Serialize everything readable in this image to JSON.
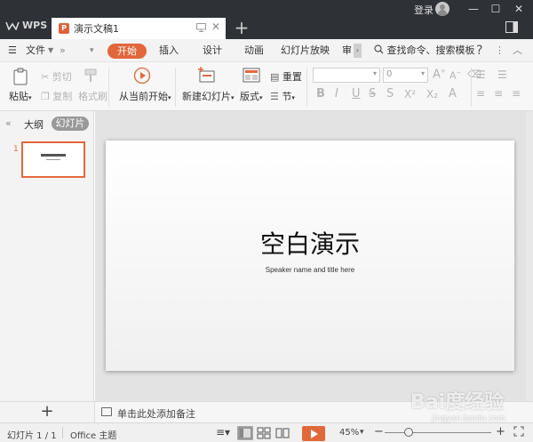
{
  "titlebar": {
    "app_name": "WPS",
    "doc_tab": "演示文稿1",
    "login": "登录",
    "new_tab": "+",
    "close_tab": "✕"
  },
  "menu": {
    "file": "文件",
    "tabs": [
      "开始",
      "插入",
      "设计",
      "动画",
      "幻灯片放映",
      "审"
    ],
    "active_tab": "开始",
    "search": "查找命令、搜索模板",
    "help": "?"
  },
  "ribbon": {
    "paste": "粘贴",
    "cut": "剪切",
    "copy": "复制",
    "format_painter": "格式刷",
    "play_from_current": "从当前开始",
    "new_slide": "新建幻灯片",
    "layout": "版式",
    "reset": "重置",
    "section": "节",
    "font_size": "0",
    "accent_color": "#e2673b"
  },
  "panel": {
    "outline_tab": "大纲",
    "slides_tab": "幻灯片",
    "slide_number": "1",
    "add_slide": "+"
  },
  "slide": {
    "title": "空白演示",
    "subtitle": "Speaker name and title here"
  },
  "notes": {
    "placeholder": "单击此处添加备注"
  },
  "status": {
    "slide_counter": "幻灯片 1 / 1",
    "theme": "Office 主题",
    "zoom": "45%",
    "zoom_minus": "−",
    "zoom_plus": "+"
  },
  "watermark": {
    "brand": "Bai度经验",
    "url": "jingyan.baidu.com"
  }
}
